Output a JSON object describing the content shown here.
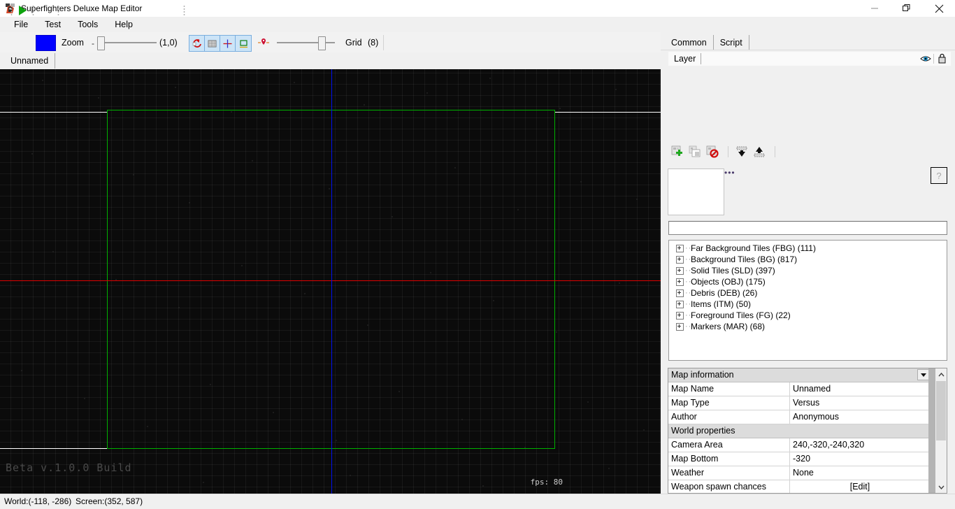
{
  "window": {
    "title": "Superfighters Deluxe Map Editor",
    "icon": "app-icon",
    "controls": {
      "minimize": "–",
      "restore": "restore-icon",
      "close": "✕"
    }
  },
  "menu": {
    "items": [
      {
        "label": "File"
      },
      {
        "label": "Test"
      },
      {
        "label": "Tools"
      },
      {
        "label": "Help"
      }
    ]
  },
  "toolbar": {
    "play_icon": "play-icon",
    "color_swatch": "#0000ff",
    "zoom_label": "Zoom",
    "minus_label": "-",
    "zoom_value": "(1,0)",
    "toggles": [
      {
        "name": "snap-rotate-icon",
        "active": true
      },
      {
        "name": "grid-icon",
        "active": true
      },
      {
        "name": "crosshair-icon",
        "active": true
      },
      {
        "name": "rectangle-icon",
        "active": true
      }
    ],
    "marker_icon": "map-pin-icon",
    "grid_label": "Grid",
    "grid_value": "(8)"
  },
  "document_tabs": [
    {
      "label": "Unnamed",
      "active": true
    }
  ],
  "canvas": {
    "beta_text": "Beta v.1.0.0 Build",
    "fps_text": "fps: 80",
    "camera_rect_color": "#00b000",
    "x_axis_color": "#dd0000",
    "y_axis_color": "#0010ee",
    "ground_line_color": "#ffffff",
    "background_color": "#0b0b0b"
  },
  "right_panel": {
    "tabs": [
      {
        "label": "Common",
        "active": true
      },
      {
        "label": "Script",
        "active": false
      }
    ],
    "layer_header": {
      "label": "Layer",
      "visibility_icon": "eye-icon",
      "lock_icon": "lock-icon"
    },
    "layer_tools": [
      {
        "name": "add-layer-icon"
      },
      {
        "name": "duplicate-layer-icon"
      },
      {
        "name": "delete-layer-icon"
      },
      {
        "name": "move-layer-down-icon"
      },
      {
        "name": "move-layer-up-icon"
      }
    ],
    "palette_dots": "•••",
    "help_button": "?",
    "search_value": "",
    "search_placeholder": "",
    "tree": [
      {
        "label": "Far Background Tiles (FBG) (111)"
      },
      {
        "label": "Background Tiles (BG) (817)"
      },
      {
        "label": "Solid Tiles (SLD) (397)"
      },
      {
        "label": "Objects (OBJ) (175)"
      },
      {
        "label": "Debris (DEB) (26)"
      },
      {
        "label": "Items (ITM) (50)"
      },
      {
        "label": "Foreground Tiles (FG) (22)"
      },
      {
        "label": "Markers (MAR) (68)"
      }
    ],
    "properties": [
      {
        "type": "category",
        "label": "Map information"
      },
      {
        "type": "text",
        "name": "Map Name",
        "value": "Unnamed"
      },
      {
        "type": "dropdown",
        "name": "Map Type",
        "value": "Versus"
      },
      {
        "type": "text",
        "name": "Author",
        "value": "Anonymous"
      },
      {
        "type": "category",
        "label": "World properties"
      },
      {
        "type": "text",
        "name": "Camera Area",
        "value": "240,-320,-240,320"
      },
      {
        "type": "text",
        "name": "Map Bottom",
        "value": "-320"
      },
      {
        "type": "dropdown",
        "name": "Weather",
        "value": "None"
      },
      {
        "type": "edit",
        "name": "Weapon spawn chances",
        "value": "[Edit]"
      }
    ]
  },
  "status_bar": {
    "world": "World:(-118, -286)",
    "screen": "Screen:(352, 587)"
  }
}
